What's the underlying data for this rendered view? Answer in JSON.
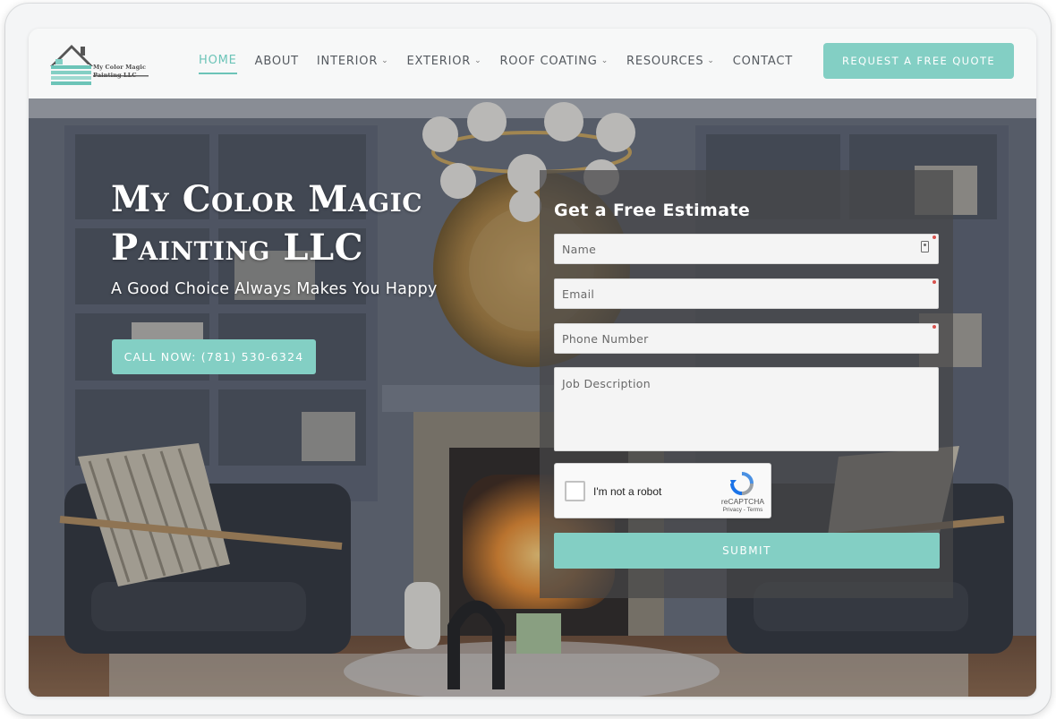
{
  "brand": {
    "logo_line1": "My Color Magic",
    "logo_line2": "Painting LLC",
    "accent": "#83cfc4",
    "active_nav": "#6cc4b8"
  },
  "nav": {
    "items": [
      {
        "label": "HOME",
        "active": true,
        "dropdown": false
      },
      {
        "label": "ABOUT",
        "active": false,
        "dropdown": false
      },
      {
        "label": "INTERIOR",
        "active": false,
        "dropdown": true
      },
      {
        "label": "EXTERIOR",
        "active": false,
        "dropdown": true
      },
      {
        "label": "ROOF COATING",
        "active": false,
        "dropdown": true
      },
      {
        "label": "RESOURCES",
        "active": false,
        "dropdown": true
      },
      {
        "label": "CONTACT",
        "active": false,
        "dropdown": false
      }
    ],
    "quote_button": "REQUEST A FREE QUOTE"
  },
  "hero": {
    "title_line1": "My Color Magic",
    "title_line2": "Painting LLC",
    "subtitle": "A Good Choice Always Makes You Happy",
    "call_button": "CALL NOW: (781) 530-6324"
  },
  "form": {
    "title": "Get a Free Estimate",
    "name_placeholder": "Name",
    "email_placeholder": "Email",
    "phone_placeholder": "Phone Number",
    "job_placeholder": "Job Description",
    "captcha_label": "I'm not a robot",
    "captcha_brand": "reCAPTCHA",
    "captcha_links": "Privacy - Terms",
    "submit": "SUBMIT"
  }
}
